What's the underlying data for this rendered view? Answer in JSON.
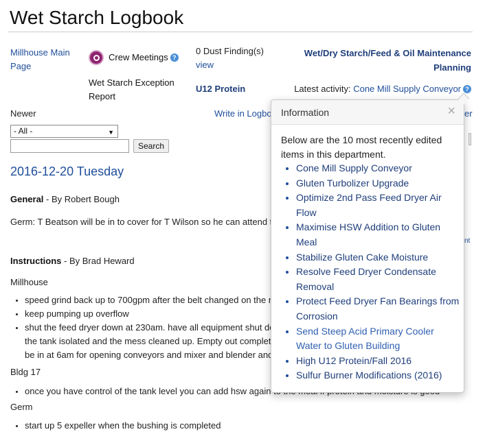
{
  "page": {
    "title": "Wet Starch Logbook"
  },
  "nav": {
    "main_page": "Millhouse Main Page",
    "crew_meetings": "Crew Meetings",
    "exception_report": "Wet Starch Exception Report",
    "dust_findings": "0 Dust Finding(s)",
    "dust_view": "view",
    "u12_protein": "U12 Protein",
    "maintenance": "Wet/Dry Starch/Feed & Oil Maintenance Planning",
    "latest_label": "Latest activity:",
    "latest_item": "Cone Mill Supply Conveyor",
    "help_glyph": "?"
  },
  "toolbar": {
    "newer": "Newer",
    "write_logbook": "Write in Logbook",
    "right_fragment": "er",
    "filter_selected": "- All -",
    "search_value": "",
    "search_button": "Search"
  },
  "log": {
    "date": "2016-12-20 Tuesday",
    "general": {
      "category": "General",
      "byline": " - By Robert Bough",
      "text": "Germ: T Beatson will be in to cover for T Wilson so he can attend t"
    },
    "edit_fragment": "nt",
    "instructions": {
      "category": "Instructions",
      "byline": " - By Brad Heward",
      "sections": [
        {
          "title": "Millhouse",
          "items": [
            "speed grind back up to 700gpm after the belt changed on the m",
            "keep pumping up overflow",
            "shut the feed dryer down at 230am. have all equipment shut do",
            "the tank isolated and the mess cleaned up. Empty out complet",
            "be in at 6am for opening conveyors and mixer and blender and"
          ]
        },
        {
          "title": "Bldg 17",
          "items": [
            "once you have control of the tank level you can add hsw again to the meal if protein and moisture is good"
          ]
        },
        {
          "title": "Germ",
          "items": [
            "start up 5 expeller when the bushing is completed"
          ]
        }
      ]
    }
  },
  "popover": {
    "title": "Information",
    "close": "×",
    "intro": "Below are the 10 most recently edited items in this department.",
    "items": [
      "Cone Mill Supply Conveyor",
      "Gluten Turbolizer Upgrade",
      "Optimize 2nd Pass Feed Dryer Air Flow",
      "Maximise HSW Addition to Gluten Meal",
      "Stabilize Gluten Cake Moisture",
      "Resolve Feed Dryer Condensate Removal",
      "Protect Feed Dryer Fan Bearings from Corrosion",
      "Send Steep Acid Primary Cooler Water to Gluten Building",
      "High U12 Protein/Fall 2016",
      "Sulfur Burner Modifications (2016)"
    ]
  },
  "colors": {
    "link": "#1f4e9a",
    "crew_icon": "#8e2470",
    "help_icon": "#4a8fd6"
  }
}
